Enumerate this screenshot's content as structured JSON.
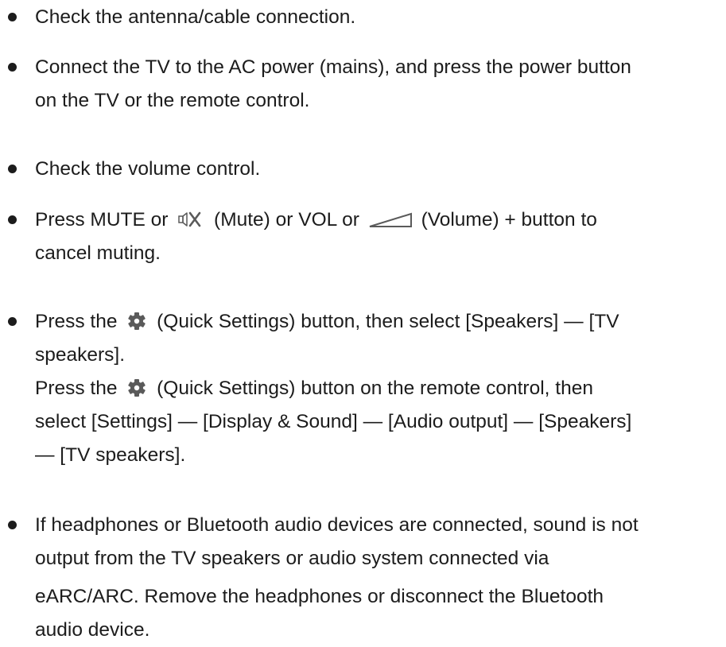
{
  "items": [
    {
      "lines": [
        "Check the antenna/cable connection."
      ]
    },
    {
      "lines": [
        "Connect the TV to the AC power (mains), and press the power button",
        "on the TV or the remote control."
      ]
    },
    {
      "lines": [
        "Check the volume control."
      ]
    },
    {
      "line1": {
        "a": "Press MUTE or ",
        "icon1": "mute-icon",
        "b": " (Mute) or VOL or ",
        "icon2": "volume-icon",
        "c": " (Volume) + button to"
      },
      "line2": "cancel muting."
    },
    {
      "line1": {
        "a": "Press the ",
        "icon": "gear-icon",
        "b": " (Quick Settings) button, then select [Speakers] — [TV"
      },
      "line2": "speakers].",
      "line3": {
        "a": "Press the ",
        "icon": "gear-icon",
        "b": " (Quick Settings) button on the remote control, then"
      },
      "line4": "select [Settings] — [Display & Sound] — [Audio output] — [Speakers]",
      "line5": "— [TV speakers]."
    },
    {
      "lines": [
        "If headphones or Bluetooth audio devices are connected, sound is not",
        "output from the TV speakers or audio system connected via",
        "eARC/ARC. Remove the headphones or disconnect the Bluetooth",
        "audio device."
      ]
    }
  ],
  "colors": {
    "text": "#1c1c1c",
    "icon": "#5a5a5a",
    "background": "#ffffff"
  }
}
